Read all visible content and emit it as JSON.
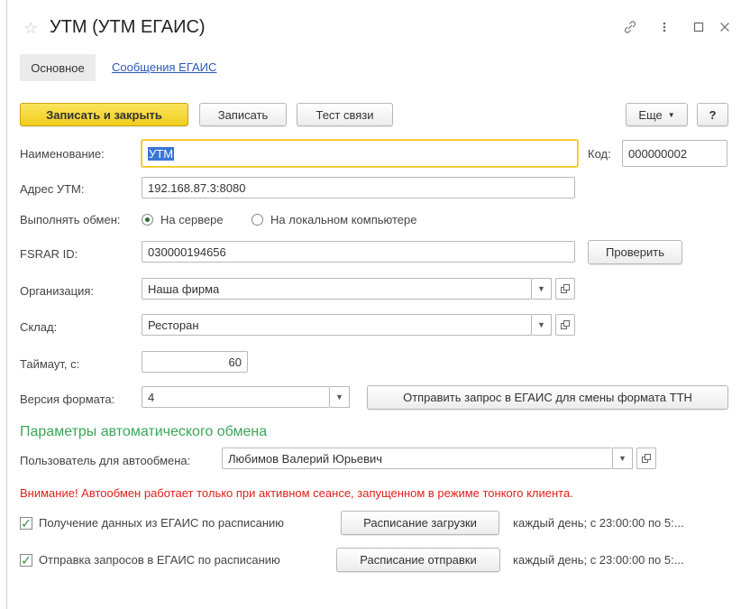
{
  "window": {
    "title": "УТМ (УТМ ЕГАИС)",
    "icons": [
      "star-icon",
      "link-icon",
      "more-icon",
      "maximize-icon",
      "close-icon"
    ]
  },
  "tabs": {
    "active": "Основное",
    "link": "Сообщения ЕГАИС"
  },
  "toolbar": {
    "save_close": "Записать и закрыть",
    "save": "Записать",
    "test": "Тест связи",
    "more": "Еще",
    "help": "?"
  },
  "form": {
    "name_label": "Наименование:",
    "name_value": "УТМ",
    "code_label": "Код:",
    "code_value": "000000002",
    "address_label": "Адрес УТМ:",
    "address_value": "192.168.87.3:8080",
    "exchange_label": "Выполнять обмен:",
    "exchange_server": "На сервере",
    "exchange_local": "На локальном компьютере",
    "fsrar_label": "FSRAR ID:",
    "fsrar_value": "030000194656",
    "check_button": "Проверить",
    "org_label": "Организация:",
    "org_value": "Наша фирма",
    "warehouse_label": "Склад:",
    "warehouse_value": "Ресторан",
    "timeout_label": "Таймаут, с:",
    "timeout_value": "60",
    "version_label": "Версия формата:",
    "version_value": "4",
    "send_request_button": "Отправить запрос в ЕГАИС для смены формата ТТН"
  },
  "auto": {
    "section_title": "Параметры автоматического обмена",
    "user_label": "Пользователь для автообмена:",
    "user_value": "Любимов Валерий Юрьевич",
    "warning": "Внимание! Автообмен работает только при активном сеансе, запущенном в режиме тонкого клиента.",
    "receive_label": "Получение данных из ЕГАИС по расписанию",
    "receive_button": "Расписание загрузки",
    "receive_schedule": "каждый день; с 23:00:00 по 5:...",
    "send_label": "Отправка запросов в ЕГАИС по расписанию",
    "send_button": "Расписание отправки",
    "send_schedule": "каждый день; с 23:00:00 по 5:..."
  },
  "colors": {
    "primary_button": "#f5d228",
    "section_title": "#3aa657",
    "warning": "#e0211b",
    "link": "#2a59b8"
  }
}
